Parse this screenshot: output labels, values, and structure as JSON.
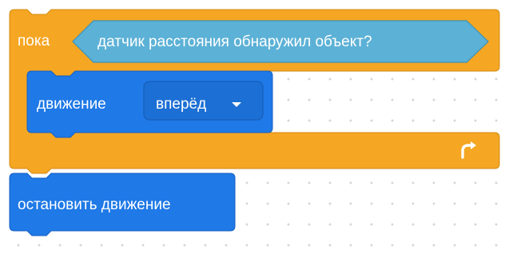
{
  "workspace": {
    "while_block": {
      "keyword": "пока",
      "condition": "датчик расстояния обнаружил объект?",
      "loop_icon": "loop-arrow-icon"
    },
    "drive_block": {
      "label": "движение",
      "dropdown_value": "вперёд",
      "dropdown_icon": "triangle-down-icon"
    },
    "stop_block": {
      "label": "остановить движение"
    }
  },
  "colors": {
    "control": "#f5a623",
    "control_border": "#d48a12",
    "sensing": "#5cb1d6",
    "sensing_border": "#3c92b9",
    "motion": "#1f79e6",
    "motion_border": "#165fc2",
    "canvas_dot": "#d3d6dc"
  }
}
